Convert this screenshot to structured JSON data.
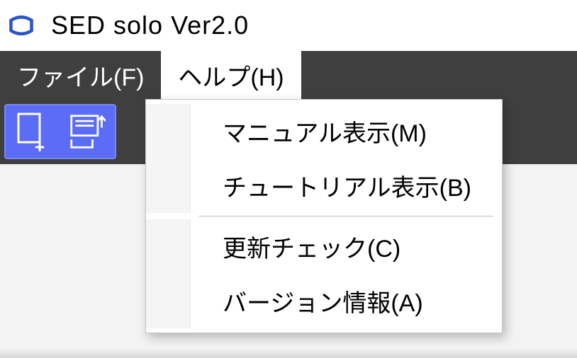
{
  "title": "SED solo Ver2.0",
  "menu": {
    "file": "ファイル(F)",
    "help": "ヘルプ(H)"
  },
  "help_menu": {
    "manual": "マニュアル表示(M)",
    "tutorial": "チュートリアル表示(B)",
    "update_check": "更新チェック(C)",
    "version_info": "バージョン情報(A)"
  },
  "icons": {
    "app": "app-icon",
    "new_doc": "new-doc-icon",
    "open_folder": "open-folder-icon"
  }
}
